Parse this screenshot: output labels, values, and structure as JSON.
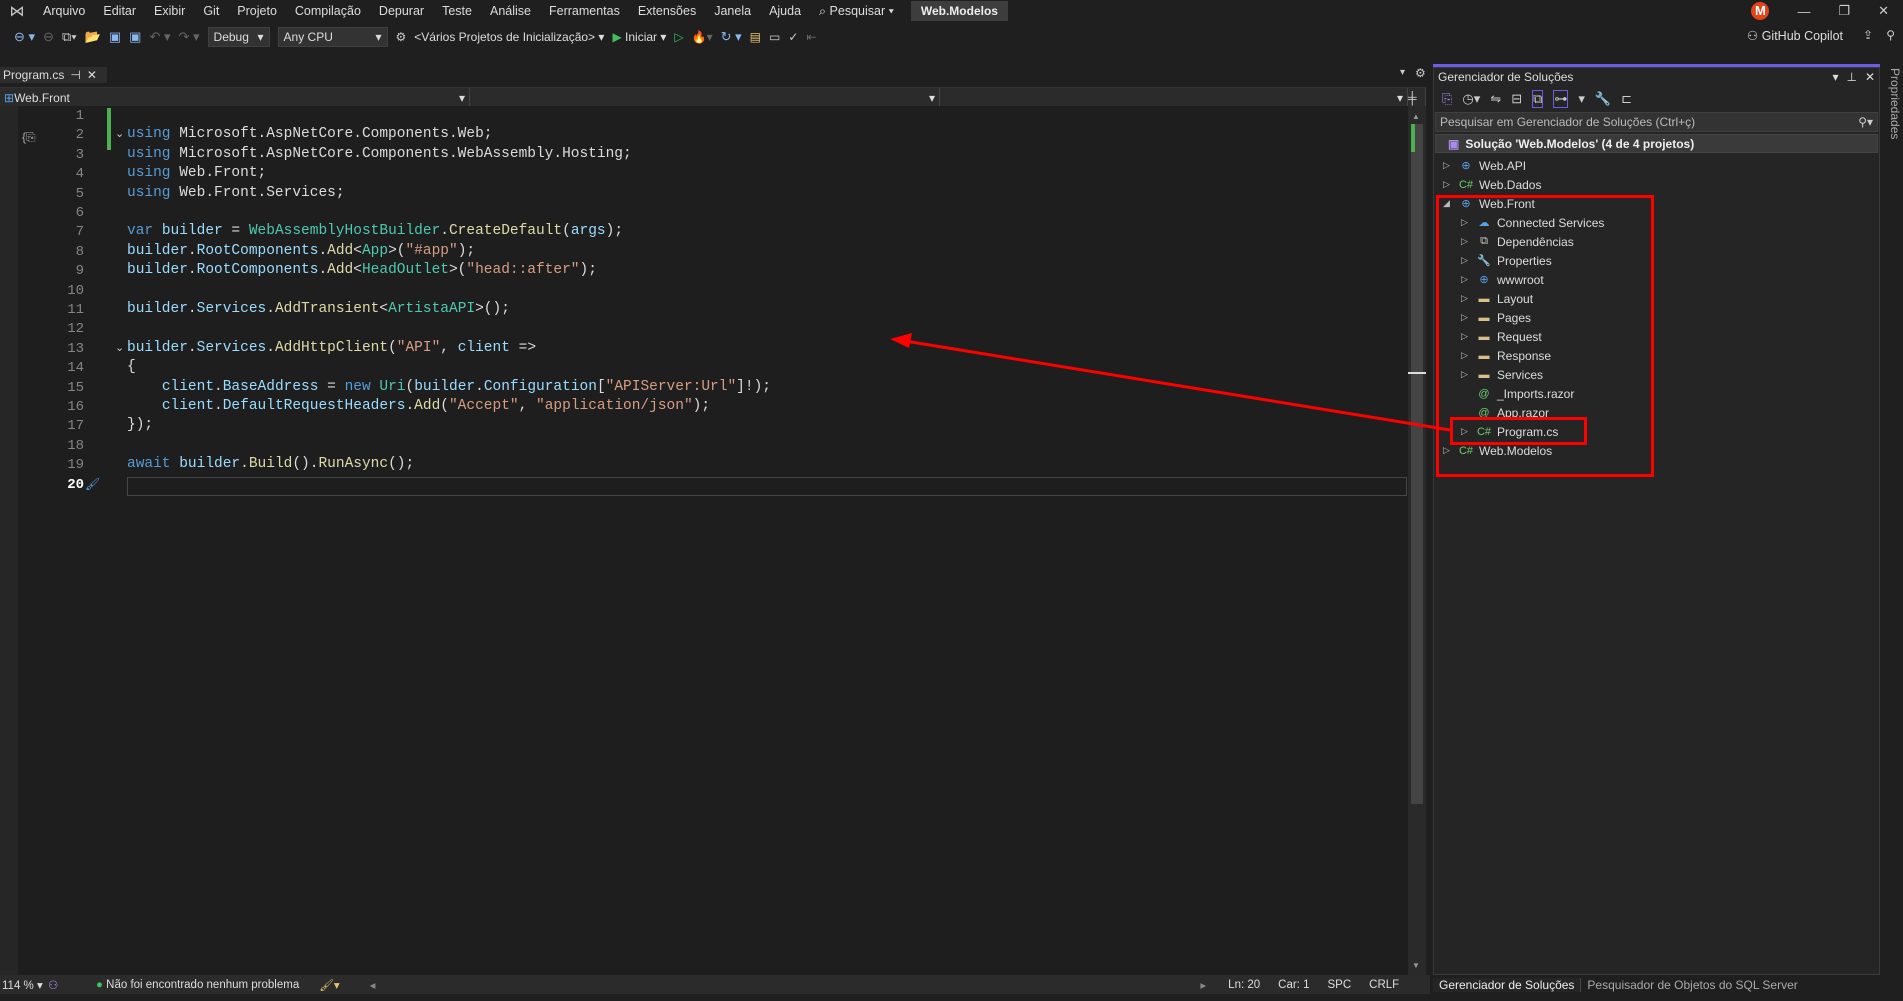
{
  "menu": {
    "items": [
      "Arquivo",
      "Editar",
      "Exibir",
      "Git",
      "Projeto",
      "Compilação",
      "Depurar",
      "Teste",
      "Análise",
      "Ferramentas",
      "Extensões",
      "Janela",
      "Ajuda"
    ],
    "search": "Pesquisar",
    "title": "Web.Modelos",
    "avatar": "M"
  },
  "toolbar": {
    "config": "Debug",
    "platform": "Any CPU",
    "startup": "<Vários Projetos de Inicialização>",
    "start": "Iniciar",
    "copilot": "GitHub Copilot"
  },
  "editor": {
    "tab": "Program.cs",
    "nav_project": "Web.Front",
    "current_line": 20,
    "lines": [
      [],
      [
        [
          "using",
          "kw"
        ],
        [
          " Microsoft.AspNetCore.Components.Web;",
          "pl"
        ]
      ],
      [
        [
          "using",
          "kw"
        ],
        [
          " Microsoft.AspNetCore.Components.WebAssembly.Hosting;",
          "pl"
        ]
      ],
      [
        [
          "using",
          "kw"
        ],
        [
          " Web.Front;",
          "pl"
        ]
      ],
      [
        [
          "using",
          "kw"
        ],
        [
          " Web.Front.Services;",
          "pl"
        ]
      ],
      [],
      [
        [
          "var",
          "kw"
        ],
        [
          " ",
          "pl"
        ],
        [
          "builder",
          "id"
        ],
        [
          " = ",
          "pl"
        ],
        [
          "WebAssemblyHostBuilder",
          "ty"
        ],
        [
          ".",
          "pl"
        ],
        [
          "CreateDefault",
          "mt"
        ],
        [
          "(",
          "pl"
        ],
        [
          "args",
          "id"
        ],
        [
          ");",
          "pl"
        ]
      ],
      [
        [
          "builder",
          "id"
        ],
        [
          ".",
          "pl"
        ],
        [
          "RootComponents",
          "id"
        ],
        [
          ".",
          "pl"
        ],
        [
          "Add",
          "mt"
        ],
        [
          "<",
          "pl"
        ],
        [
          "App",
          "ty"
        ],
        [
          ">(",
          "pl"
        ],
        [
          "\"#app\"",
          "st"
        ],
        [
          ");",
          "pl"
        ]
      ],
      [
        [
          "builder",
          "id"
        ],
        [
          ".",
          "pl"
        ],
        [
          "RootComponents",
          "id"
        ],
        [
          ".",
          "pl"
        ],
        [
          "Add",
          "mt"
        ],
        [
          "<",
          "pl"
        ],
        [
          "HeadOutlet",
          "ty"
        ],
        [
          ">(",
          "pl"
        ],
        [
          "\"head::after\"",
          "st"
        ],
        [
          ");",
          "pl"
        ]
      ],
      [],
      [
        [
          "builder",
          "id"
        ],
        [
          ".",
          "pl"
        ],
        [
          "Services",
          "id"
        ],
        [
          ".",
          "pl"
        ],
        [
          "AddTransient",
          "mt"
        ],
        [
          "<",
          "pl"
        ],
        [
          "ArtistaAPI",
          "ty"
        ],
        [
          ">();",
          "pl"
        ]
      ],
      [],
      [
        [
          "builder",
          "id"
        ],
        [
          ".",
          "pl"
        ],
        [
          "Services",
          "id"
        ],
        [
          ".",
          "pl"
        ],
        [
          "AddHttpClient",
          "mt"
        ],
        [
          "(",
          "pl"
        ],
        [
          "\"API\"",
          "st"
        ],
        [
          ", ",
          "pl"
        ],
        [
          "client",
          "id"
        ],
        [
          " =>",
          "pl"
        ]
      ],
      [
        [
          "{",
          "pl"
        ]
      ],
      [
        [
          "    ",
          "pl"
        ],
        [
          "client",
          "id"
        ],
        [
          ".",
          "pl"
        ],
        [
          "BaseAddress",
          "id"
        ],
        [
          " = ",
          "pl"
        ],
        [
          "new",
          "kw"
        ],
        [
          " ",
          "pl"
        ],
        [
          "Uri",
          "ty"
        ],
        [
          "(",
          "pl"
        ],
        [
          "builder",
          "id"
        ],
        [
          ".",
          "pl"
        ],
        [
          "Configuration",
          "id"
        ],
        [
          "[",
          "pl"
        ],
        [
          "\"APIServer:Url\"",
          "st"
        ],
        [
          "]!);",
          "pl"
        ]
      ],
      [
        [
          "    ",
          "pl"
        ],
        [
          "client",
          "id"
        ],
        [
          ".",
          "pl"
        ],
        [
          "DefaultRequestHeaders",
          "id"
        ],
        [
          ".",
          "pl"
        ],
        [
          "Add",
          "mt"
        ],
        [
          "(",
          "pl"
        ],
        [
          "\"Accept\"",
          "st"
        ],
        [
          ", ",
          "pl"
        ],
        [
          "\"application/json\"",
          "st"
        ],
        [
          ");",
          "pl"
        ]
      ],
      [
        [
          "});",
          "pl"
        ]
      ],
      [],
      [
        [
          "await",
          "kw"
        ],
        [
          " ",
          "pl"
        ],
        [
          "builder",
          "id"
        ],
        [
          ".",
          "pl"
        ],
        [
          "Build",
          "mt"
        ],
        [
          "().",
          "pl"
        ],
        [
          "RunAsync",
          "mt"
        ],
        [
          "();",
          "pl"
        ]
      ],
      []
    ]
  },
  "solution_explorer": {
    "title": "Gerenciador de Soluções",
    "search_placeholder": "Pesquisar em Gerenciador de Soluções (Ctrl+ç)",
    "solution": "Solução 'Web.Modelos' (4 de 4 projetos)",
    "items": [
      {
        "label": "Web.API",
        "level": 0,
        "expander": "collapsed",
        "icon": "web-project-icon"
      },
      {
        "label": "Web.Dados",
        "level": 0,
        "expander": "collapsed",
        "icon": "csharp-project-icon"
      },
      {
        "label": "Web.Front",
        "level": 0,
        "expander": "expanded",
        "icon": "web-project-icon"
      },
      {
        "label": "Connected Services",
        "level": 1,
        "expander": "collapsed",
        "icon": "connected-services-icon"
      },
      {
        "label": "Dependências",
        "level": 1,
        "expander": "collapsed",
        "icon": "dependencies-icon"
      },
      {
        "label": "Properties",
        "level": 1,
        "expander": "collapsed",
        "icon": "properties-folder-icon"
      },
      {
        "label": "wwwroot",
        "level": 1,
        "expander": "collapsed",
        "icon": "globe-icon"
      },
      {
        "label": "Layout",
        "level": 1,
        "expander": "collapsed",
        "icon": "folder-icon"
      },
      {
        "label": "Pages",
        "level": 1,
        "expander": "collapsed",
        "icon": "folder-icon"
      },
      {
        "label": "Request",
        "level": 1,
        "expander": "collapsed",
        "icon": "folder-icon"
      },
      {
        "label": "Response",
        "level": 1,
        "expander": "collapsed",
        "icon": "folder-icon"
      },
      {
        "label": "Services",
        "level": 1,
        "expander": "collapsed",
        "icon": "folder-icon"
      },
      {
        "label": "_Imports.razor",
        "level": 1,
        "expander": "none",
        "icon": "razor-file-icon"
      },
      {
        "label": "App.razor",
        "level": 1,
        "expander": "none",
        "icon": "razor-file-icon"
      },
      {
        "label": "Program.cs",
        "level": 1,
        "expander": "collapsed",
        "icon": "csharp-file-icon"
      },
      {
        "label": "Web.Modelos",
        "level": 0,
        "expander": "collapsed",
        "icon": "csharp-project-icon"
      }
    ],
    "bottom_tabs": [
      "Gerenciador de Soluções",
      "Pesquisador de Objetos do SQL Server"
    ]
  },
  "side_panel": "Propriedades",
  "status": {
    "zoom": "114 %",
    "issues": "Não foi encontrado nenhum problema",
    "ln": "Ln: 20",
    "col": "Car: 1",
    "spc": "SPC",
    "eol": "CRLF"
  },
  "annotation_color": "#ff0000"
}
